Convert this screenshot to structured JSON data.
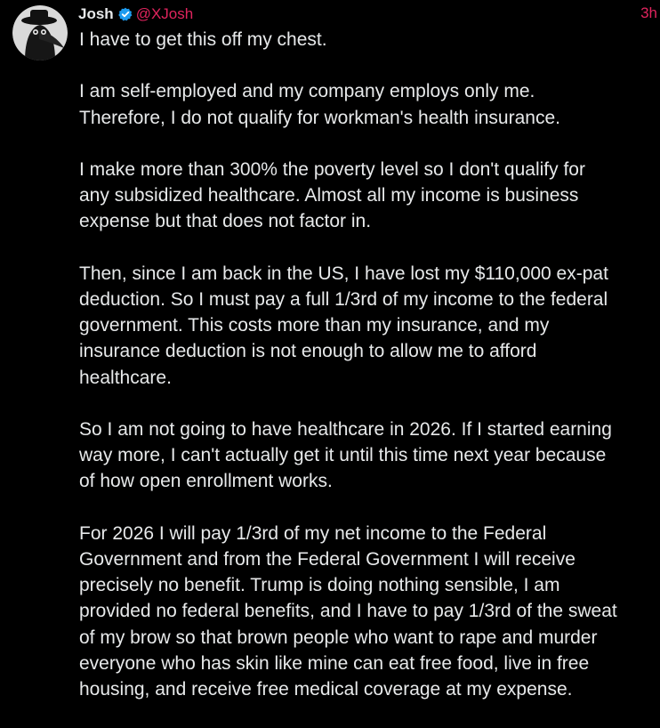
{
  "post": {
    "author": {
      "display_name": "Josh",
      "handle": "@XJosh",
      "verified_icon": "verified-badge-icon",
      "avatar_icon": "avatar-image"
    },
    "timestamp": "3h",
    "paragraphs": [
      "I have to get this off my chest.",
      "I am self-employed and my company employs only me.\nTherefore, I do not qualify for workman's health insurance.",
      "I make more than 300% the poverty level so I don't qualify for\nany subsidized healthcare. Almost all my income is business\nexpense but that does not factor in.",
      "Then, since I am back in the US, I have lost my $110,000 ex-pat\ndeduction. So I must pay a full 1/3rd of my income to the federal\ngovernment. This costs more than my insurance, and my\ninsurance deduction is not enough to allow me to afford\nhealthcare.",
      "So I am not going to have healthcare in 2026. If I started earning\nway more, I can't actually get it until this time next year because\nof how open enrollment works.",
      "For 2026 I will pay 1/3rd of my net income to the Federal\nGovernment and from the Federal Government I will receive\nprecisely no benefit. Trump is doing nothing sensible, I am\nprovided no federal benefits, and I have to pay 1/3rd of the sweat\nof my brow so that brown people who want to rape and murder\neveryone who has skin like mine can eat free food, live in free\nhousing, and receive free medical coverage at my expense."
    ]
  },
  "colors": {
    "background": "#000000",
    "text": "#e7e9ea",
    "handle": "#e0245e",
    "verified": "#1d9bf0"
  }
}
